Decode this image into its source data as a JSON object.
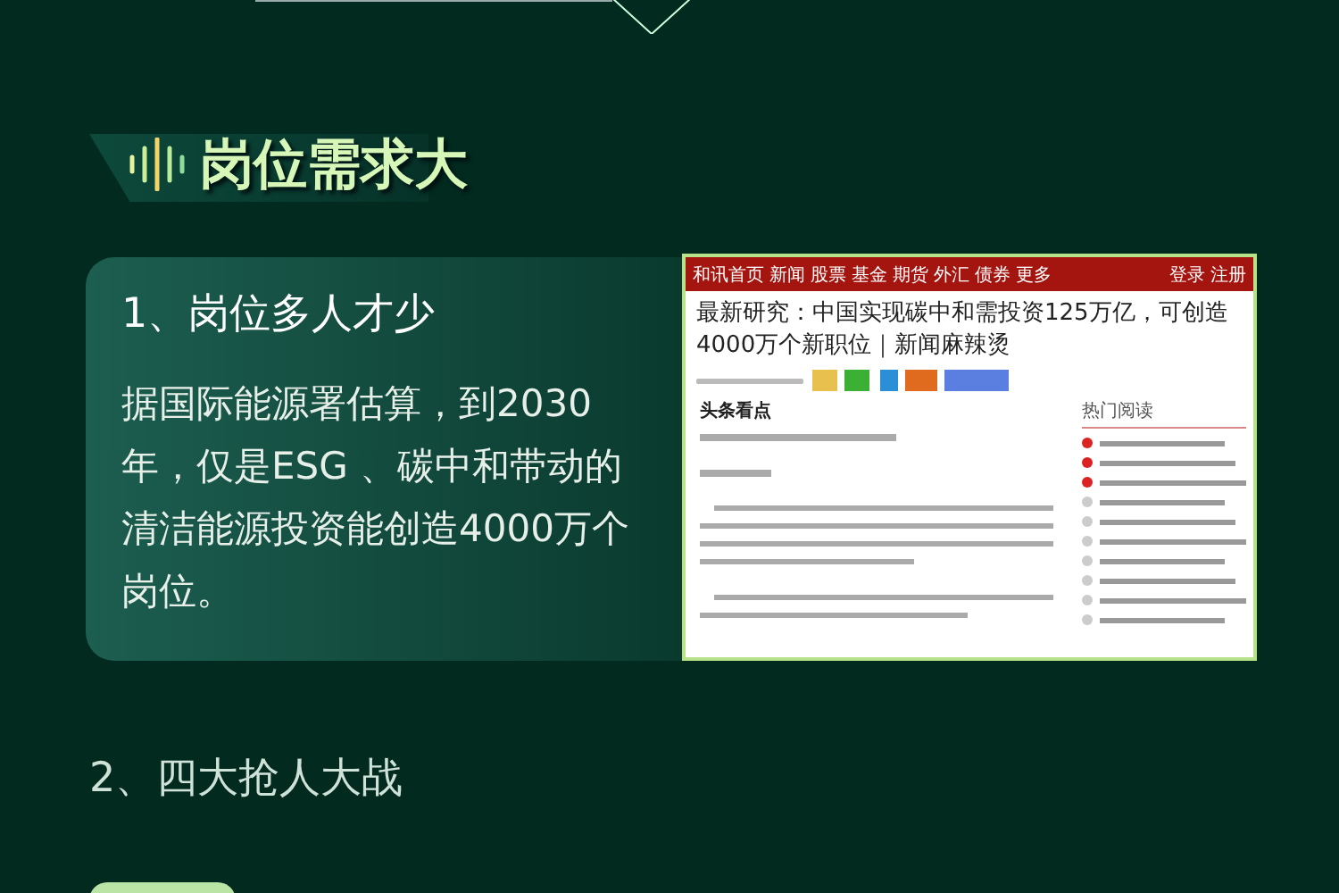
{
  "section_title": "岗位需求大",
  "card": {
    "heading": "1、岗位多人才少",
    "body": "据国际能源署估算，到2030年，仅是ESG 、碳中和带动的清洁能源投资能创造4000万个岗位。",
    "screenshot": {
      "nav": [
        "和讯首页",
        "新闻",
        "股票",
        "基金",
        "期货",
        "外汇",
        "债券",
        "更多"
      ],
      "login": "登录",
      "register": "注册",
      "headline": "最新研究：中国实现碳中和需投资125万亿，可创造4000万个新职位｜新闻麻辣烫",
      "section_heading": "头条看点",
      "sidebar_heading": "热门阅读"
    }
  },
  "next_heading": "2、四大抢人大战"
}
